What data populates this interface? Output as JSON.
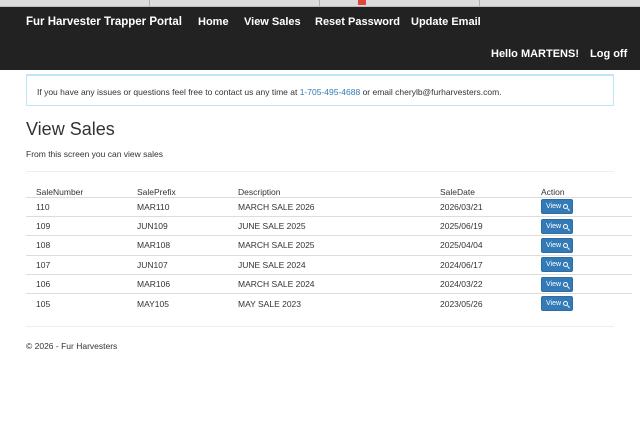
{
  "navbar": {
    "brand": "Fur Harvester Trapper Portal",
    "links": [
      "Home",
      "View Sales",
      "Reset Password",
      "Update Email"
    ],
    "greeting": "Hello MARTENS!",
    "logoff": "Log off"
  },
  "alert": {
    "prefix": "If you have any issues or questions feel free to contact us any time at ",
    "phone": "1-705-495-4688",
    "suffix": " or email cherylb@furharvesters.com."
  },
  "main": {
    "title": "View Sales",
    "subtitle": "From this screen you can view sales"
  },
  "table": {
    "headers": [
      "SaleNumber",
      "SalePrefix",
      "Description",
      "SaleDate",
      "Action"
    ],
    "rows": [
      [
        "110",
        "MAR110",
        "MARCH SALE 2026",
        "2026/03/21"
      ],
      [
        "109",
        "JUN109",
        "JUNE SALE 2025",
        "2025/06/19"
      ],
      [
        "108",
        "MAR108",
        "MARCH SALE 2025",
        "2025/04/04"
      ],
      [
        "107",
        "JUN107",
        "JUNE SALE 2024",
        "2024/06/17"
      ],
      [
        "106",
        "MAR106",
        "MARCH SALE 2024",
        "2024/03/22"
      ],
      [
        "105",
        "MAY105",
        "MAY SALE 2023",
        "2023/05/26"
      ]
    ],
    "view_label": "View",
    "view_icon": "search-icon"
  },
  "footer": {
    "text": "© 2026 - Fur Harvesters"
  },
  "colors": {
    "navbar": "#222222",
    "link": "#337ab7",
    "button": "#337ab7",
    "alert_border": "#bce8f1"
  }
}
